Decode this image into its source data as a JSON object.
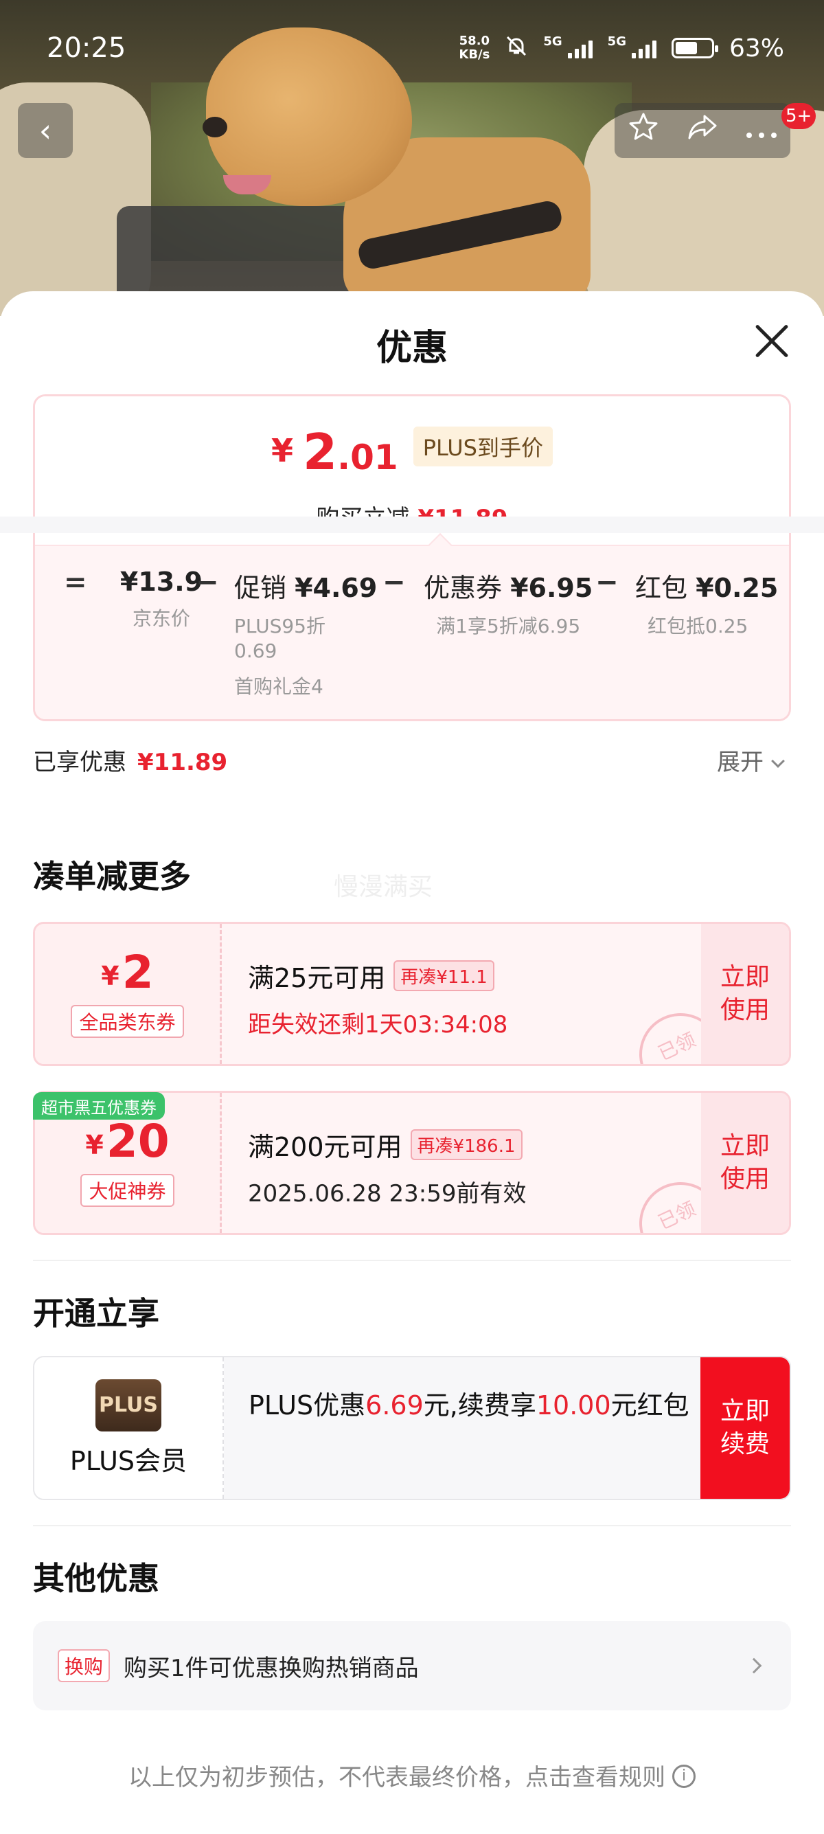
{
  "status_bar": {
    "time": "20:25",
    "net_speed_value": "58.0",
    "net_speed_unit": "KB/s",
    "net1": "5G",
    "net2": "5G",
    "battery_pct": "63%",
    "battery_level": 0.63
  },
  "nav": {
    "back_icon": "‹",
    "badge": "5+"
  },
  "sheet": {
    "title": "优惠"
  },
  "price": {
    "yen": "¥",
    "int": "2",
    "dec": ".01",
    "plus_tag": "PLUS到手价",
    "instant_label": "购买立减",
    "instant_value": "¥11.89"
  },
  "breakdown": {
    "eq": "=",
    "minus": "−",
    "items": [
      {
        "label": "",
        "value": "¥13.9",
        "sub": "京东价",
        "sub2": ""
      },
      {
        "label": "促销",
        "value": "¥4.69",
        "sub": "PLUS95折 0.69",
        "sub2": "首购礼金4"
      },
      {
        "label": "优惠券",
        "value": "¥6.95",
        "sub": "满1享5折减6.95",
        "sub2": ""
      },
      {
        "label": "红包",
        "value": "¥0.25",
        "sub": "红包抵0.25",
        "sub2": ""
      }
    ]
  },
  "enjoyed": {
    "label": "已享优惠",
    "value": "¥11.89",
    "expand": "展开"
  },
  "more_section": {
    "title": "凑单减更多",
    "watermark": "慢漫满买"
  },
  "coupons": [
    {
      "yen": "¥",
      "amount": "2",
      "kind": "全品类东券",
      "cond": "满25元可用",
      "more": "再凑¥11.1",
      "desc": "距失效还剩1天03:34:08",
      "action": "立即使用",
      "stamp": "已领"
    },
    {
      "badge": "超市黑五优惠券",
      "yen": "¥",
      "amount": "20",
      "kind": "大促神券",
      "cond": "满200元可用",
      "more": "再凑¥186.1",
      "desc": "2025.06.28 23:59前有效",
      "action": "立即使用",
      "stamp": "已领"
    }
  ],
  "plus_section": {
    "title": "开通立享",
    "logo": "PLUS",
    "name": "PLUS会员",
    "text1": "PLUS优惠",
    "amount1": "6.69",
    "text2": "元,续费享",
    "amount2": "10.00",
    "text3": "元红包",
    "action": "立即续费"
  },
  "other_section": {
    "title": "其他优惠",
    "tag": "换购",
    "text": "购买1件可优惠换购热销商品"
  },
  "footer": {
    "note": "以上仅为初步预估，不代表最终价格，点击查看规则",
    "info_icon": "i"
  },
  "colors": {
    "accent": "#e8222f",
    "plus_brown": "#3e2a1c",
    "badge_green": "#3cc26a"
  }
}
